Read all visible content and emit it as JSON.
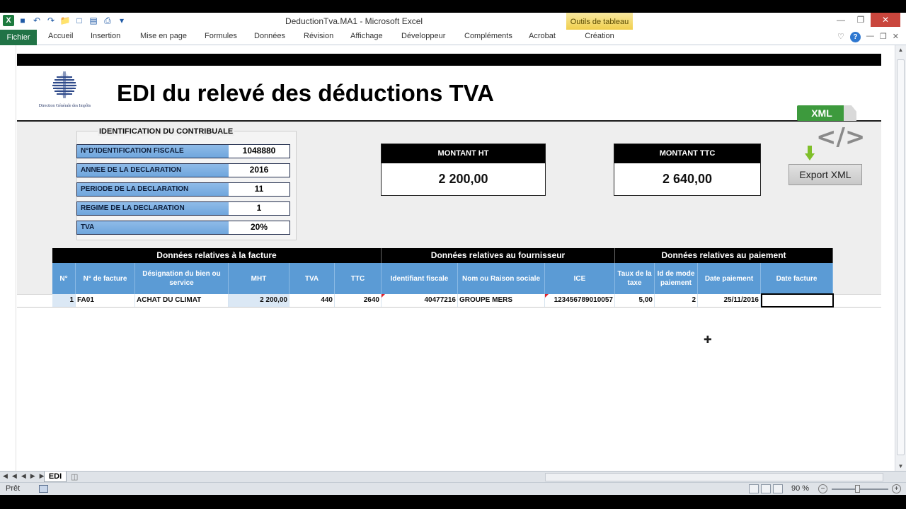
{
  "window": {
    "title": "DeductionTva.MA1 - Microsoft Excel",
    "contextual_tab_group": "Outils de tableau"
  },
  "ribbon": {
    "tabs": [
      "Fichier",
      "Accueil",
      "Insertion",
      "Mise en page",
      "Formules",
      "Données",
      "Révision",
      "Affichage",
      "Développeur",
      "Compléments",
      "Acrobat",
      "Création"
    ]
  },
  "header": {
    "logo_caption": "Direction Générale des Impôts",
    "title": "EDI du relevé des déductions TVA"
  },
  "identification": {
    "title": "IDENTIFICATION  DU CONTRIBUALE",
    "rows": [
      {
        "label": "N°D'IDENTIFICATION FISCALE",
        "value": "1048880"
      },
      {
        "label": "ANNEE DE LA DECLARATION",
        "value": "2016"
      },
      {
        "label": "PERIODE DE LA DECLARATION",
        "value": "11"
      },
      {
        "label": "REGIME DE LA DECLARATION",
        "value": "1"
      },
      {
        "label": "TVA",
        "value": "20%"
      }
    ]
  },
  "totals": {
    "ht_label": "MONTANT HT",
    "ht_value": "2 200,00",
    "ttc_label": "MONTANT TTC",
    "ttc_value": "2 640,00"
  },
  "export": {
    "badge": "XML",
    "code_glyph": "</>",
    "button_label": "Export XML",
    "badge_color": "#3d9a3d"
  },
  "table": {
    "groups": [
      "Données relatives à la facture",
      "Données relatives au fournisseur",
      "Données relatives au paiement"
    ],
    "columns": [
      "N°",
      "N° de facture",
      "Désignation du bien ou service",
      "MHT",
      "TVA",
      "TTC",
      "Identifiant fiscale",
      "Nom ou Raison sociale",
      "ICE",
      "Taux de la taxe",
      "Id de mode paiement",
      "Date paiement",
      "Date facture"
    ],
    "rows": [
      [
        "1",
        "FA01",
        "ACHAT DU CLIMAT",
        "2 200,00",
        "440",
        "2640",
        "40477216",
        "GROUPE MERS",
        "123456789010057",
        "5,00",
        "2",
        "25/11/2016",
        ""
      ]
    ],
    "header_color": "#5b9bd5"
  },
  "sheets": {
    "active": "EDI"
  },
  "status": {
    "mode": "Prêt",
    "zoom": "90 %"
  }
}
